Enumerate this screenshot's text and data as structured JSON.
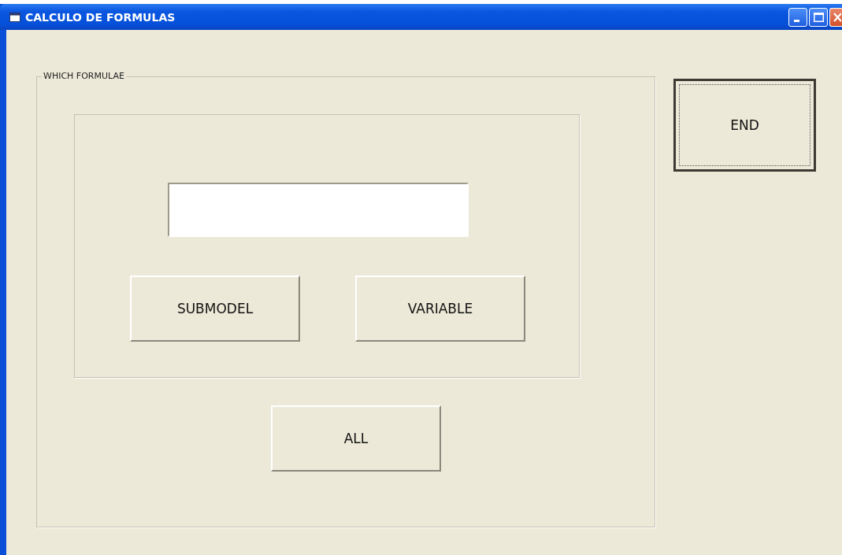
{
  "window": {
    "title": "CALCULO DE FORMULAS"
  },
  "frame": {
    "legend": "WHICH FORMULAE",
    "panel_buttons": [
      {
        "label": "SUBMODEL",
        "focused": false
      },
      {
        "label": "VARIABLE",
        "focused": false
      }
    ],
    "bottom_button": {
      "label": "ALL",
      "focused": false
    }
  },
  "end_button": {
    "label": "END",
    "focused": true
  }
}
